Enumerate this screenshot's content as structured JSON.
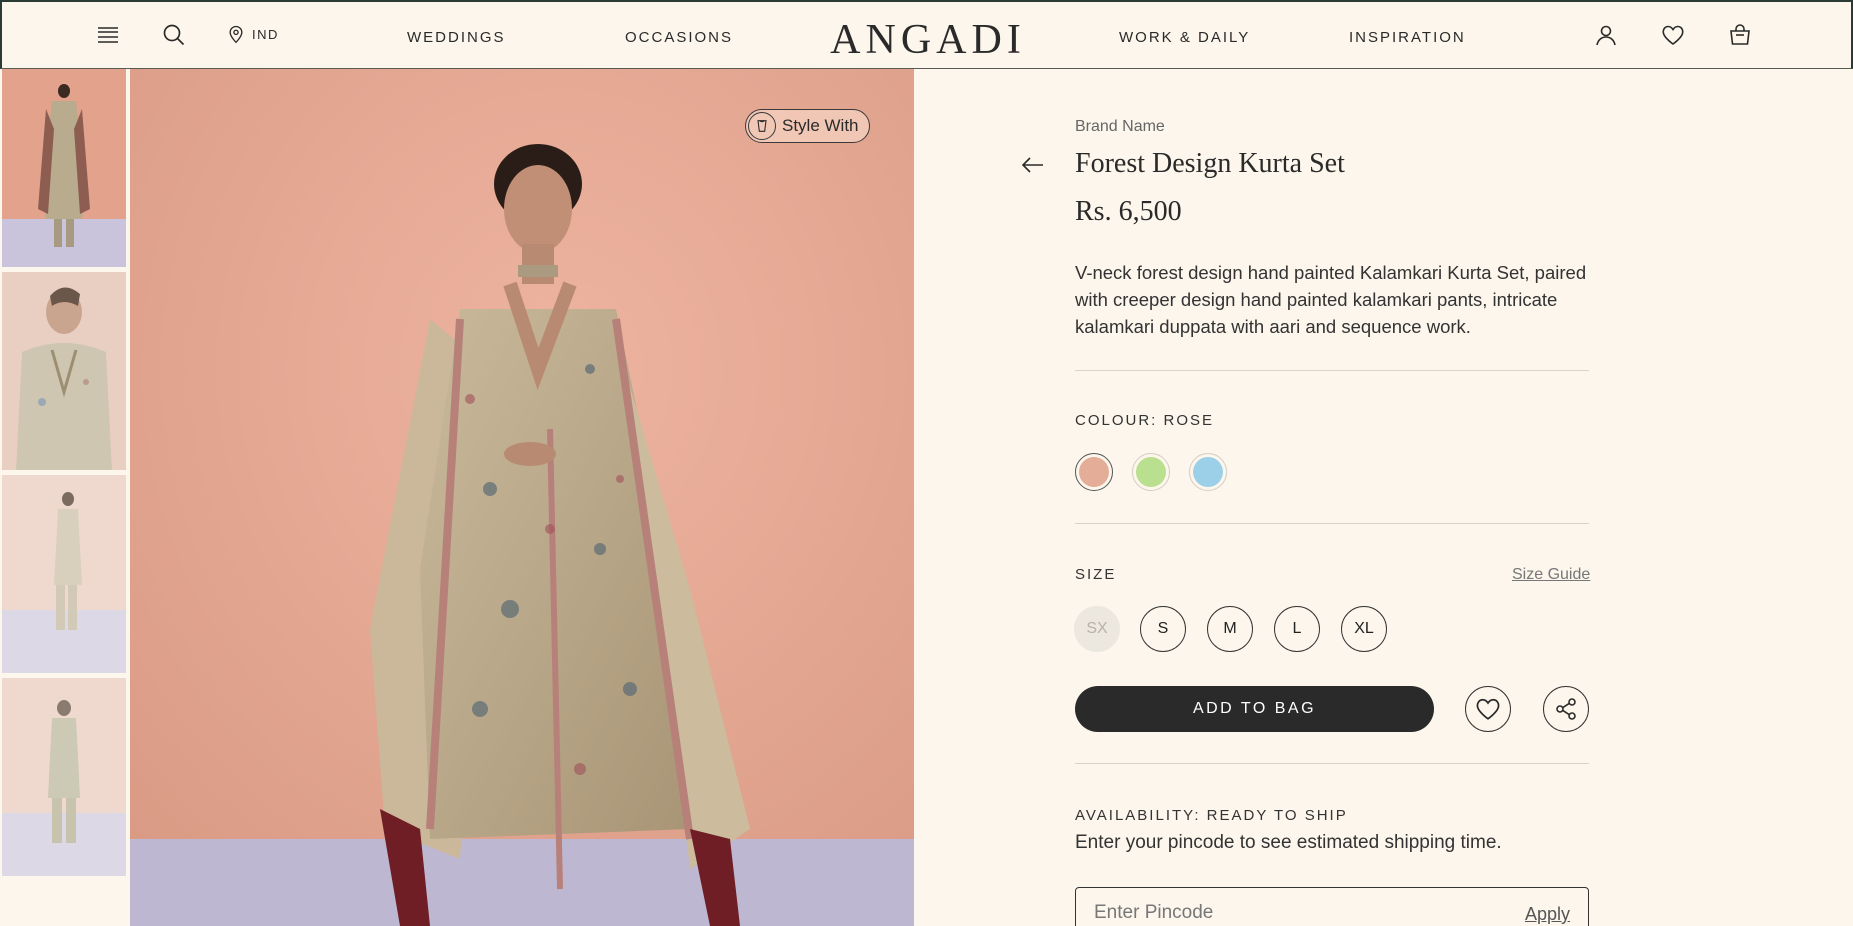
{
  "header": {
    "menu_icon": "hamburger-icon",
    "search_icon": "search-icon",
    "region_icon": "location-pin-icon",
    "region": "IND",
    "nav": [
      "WEDDINGS",
      "OCCASIONS",
      "WORK & DAILY",
      "INSPIRATION"
    ],
    "logo": "ANGADI",
    "account_icon": "user-icon",
    "wishlist_icon": "heart-icon",
    "bag_icon": "shopping-bag-icon"
  },
  "gallery": {
    "style_with_label": "Style With",
    "thumbnails_count": 4
  },
  "product": {
    "brand": "Brand Name",
    "title": "Forest Design Kurta Set",
    "price": "Rs. 6,500",
    "description": "V-neck forest design hand painted Kalamkari Kurta Set, paired with creeper design hand painted kalamkari pants, intricate kalamkari duppata with aari and sequence work.",
    "colour_label": "COLOUR: ROSE",
    "colours": [
      {
        "name": "Rose",
        "hex": "#e3ad98",
        "selected": true
      },
      {
        "name": "Green",
        "hex": "#b9e08f",
        "selected": false
      },
      {
        "name": "Blue",
        "hex": "#9ccfe8",
        "selected": false
      }
    ],
    "size_label": "SIZE",
    "size_guide": "Size Guide",
    "sizes": [
      {
        "label": "SX",
        "available": false
      },
      {
        "label": "S",
        "available": true
      },
      {
        "label": "M",
        "available": true
      },
      {
        "label": "L",
        "available": true
      },
      {
        "label": "XL",
        "available": true
      }
    ],
    "add_to_bag": "ADD TO BAG",
    "availability": "AVAILABILITY: READY TO SHIP",
    "shipping_text": "Enter your pincode to see estimated shipping time.",
    "pincode_placeholder": "Enter Pincode",
    "apply_label": "Apply"
  },
  "colors": {
    "background": "#fcf6ec",
    "text": "#2a2a2a",
    "button_dark": "#2a2a2a",
    "photo_wall": "#e7a891",
    "photo_floor": "#bfb9d6"
  }
}
